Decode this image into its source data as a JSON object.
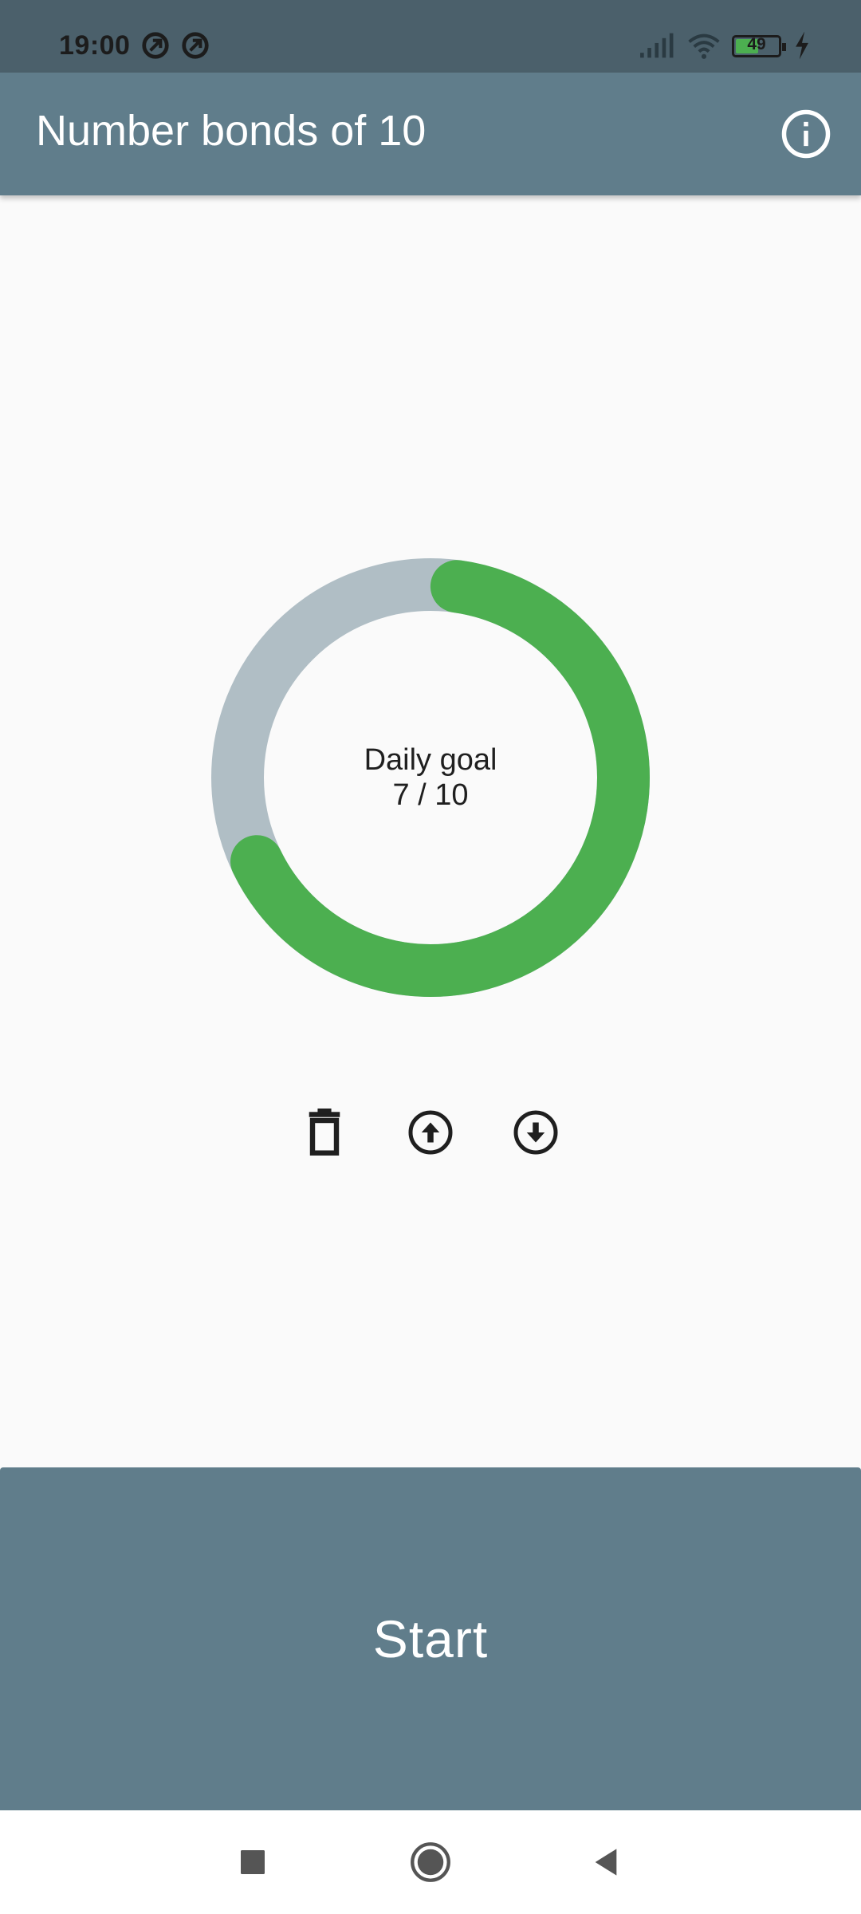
{
  "status_bar": {
    "time": "19:00",
    "battery_level": "49",
    "icons": [
      "sync-icon",
      "sync-icon",
      "signal-icon",
      "wifi-icon",
      "battery-icon",
      "charging-icon"
    ]
  },
  "app_bar": {
    "title": "Number bonds of 10",
    "info_icon": "info-icon"
  },
  "daily_goal": {
    "label": "Daily goal",
    "progress_text": "7 / 10",
    "completed": 7,
    "total": 10,
    "progress_color": "#4caf50",
    "track_color": "#b0bec5"
  },
  "actions": {
    "icons": [
      "delete-icon",
      "upload-icon",
      "download-icon"
    ]
  },
  "start_button": {
    "label": "Start"
  },
  "nav_bar": {
    "icons": [
      "recents-icon",
      "home-icon",
      "back-icon"
    ]
  },
  "colors": {
    "status_bar": "#4b606b",
    "app_bar": "#607d8b",
    "background": "#fafafa",
    "accent": "#4caf50"
  }
}
